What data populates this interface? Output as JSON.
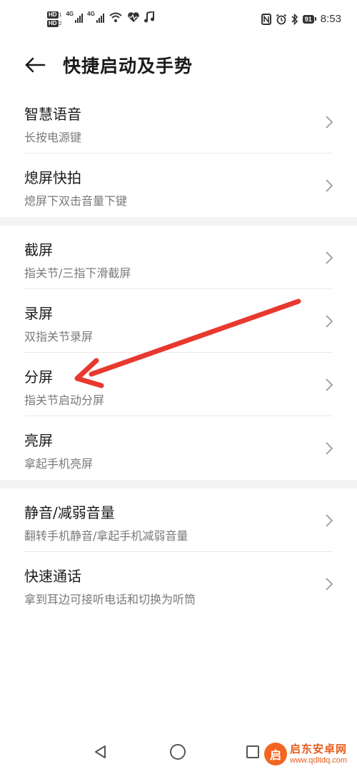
{
  "status_bar": {
    "left_tags": [
      "HD",
      "HD"
    ],
    "network_labels": [
      "4G",
      "4G"
    ],
    "right_icons": [
      "nfc-icon",
      "alarm-icon",
      "bluetooth-icon"
    ],
    "battery_level": "91",
    "time": "8:53"
  },
  "header": {
    "back_icon": "back-arrow-icon",
    "title": "快捷启动及手势"
  },
  "groups": [
    {
      "items": [
        {
          "title": "智慧语音",
          "subtitle": "长按电源键"
        },
        {
          "title": "熄屏快拍",
          "subtitle": "熄屏下双击音量下键"
        }
      ]
    },
    {
      "items": [
        {
          "title": "截屏",
          "subtitle": "指关节/三指下滑截屏"
        },
        {
          "title": "录屏",
          "subtitle": "双指关节录屏"
        },
        {
          "title": "分屏",
          "subtitle": "指关节启动分屏"
        },
        {
          "title": "亮屏",
          "subtitle": "拿起手机亮屏"
        }
      ]
    },
    {
      "items": [
        {
          "title": "静音/减弱音量",
          "subtitle": "翻转手机静音/拿起手机减弱音量"
        },
        {
          "title": "快速通话",
          "subtitle": "拿到耳边可接听电话和切换为听筒"
        }
      ]
    }
  ],
  "annotation": {
    "color": "#e8392f"
  },
  "nav_bar": {
    "icons": [
      "back-triangle-icon",
      "home-circle-icon",
      "recents-square-icon"
    ]
  },
  "watermark": {
    "badge": "启",
    "name": "启东安卓网",
    "url": "www.qdltdq.com"
  }
}
